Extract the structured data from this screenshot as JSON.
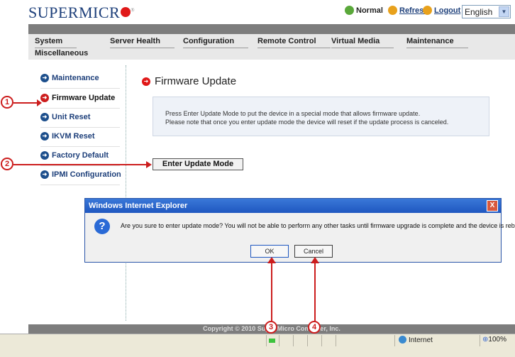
{
  "header": {
    "logo_text": "SUPERMICR",
    "logo_mark": "®",
    "status_label": "Normal",
    "refresh_label": "Refresh",
    "logout_label": "Logout",
    "language": "English"
  },
  "menu": {
    "items": [
      "System",
      "Server Health",
      "Configuration",
      "Remote Control",
      "Virtual Media",
      "Maintenance"
    ],
    "second_row": "Miscellaneous"
  },
  "sidebar": {
    "items": [
      "Maintenance",
      "Firmware Update",
      "Unit Reset",
      "IKVM Reset",
      "Factory Default",
      "IPMI Configuration"
    ]
  },
  "main": {
    "title": "Firmware Update",
    "info_line1": "Press Enter Update Mode to put the device in a special mode that allows firmware update.",
    "info_line2": "Please note that once you enter update mode the device will reset if the update process is canceled.",
    "button_label": "Enter Update Mode"
  },
  "dialog": {
    "title": "Windows Internet Explorer",
    "message": "Are you sure to enter update mode? You will not be able to perform any other tasks until firmware upgrade is complete and the device is rebooted.",
    "ok_label": "OK",
    "cancel_label": "Cancel",
    "close_glyph": "X",
    "icon_glyph": "?"
  },
  "footer": {
    "copyright": "Copyright © 2010 Super Micro Computer, Inc."
  },
  "statusbar": {
    "zone": "Internet",
    "zoom": "100%"
  },
  "annotations": [
    "1",
    "2",
    "3",
    "4"
  ],
  "colors": {
    "accent": "#cc1d1d",
    "brand": "#1d3f7a",
    "titlebar": "#1f57c0"
  }
}
